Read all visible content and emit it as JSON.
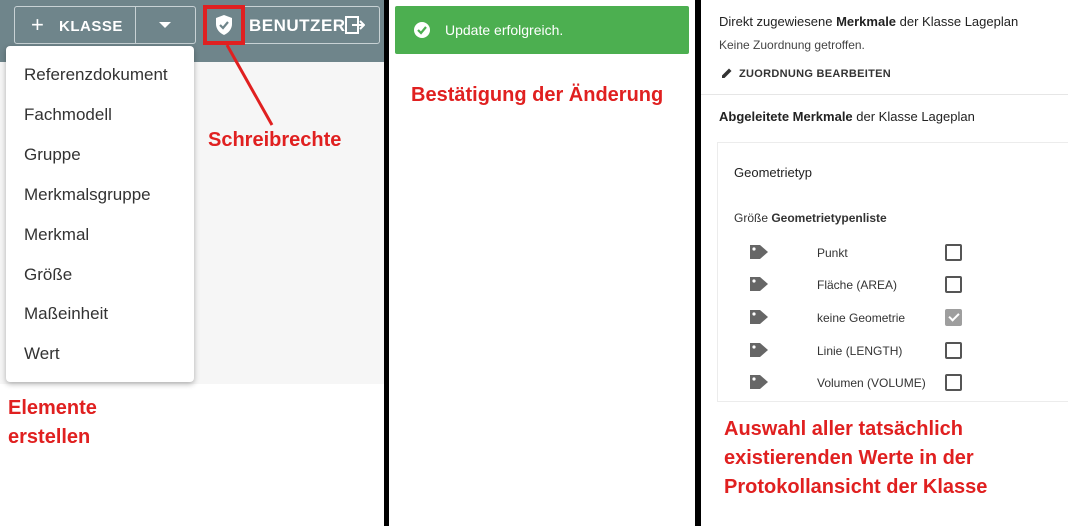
{
  "panel1": {
    "toolbar": {
      "new_class_button": "KLASSE",
      "user_button": "BENUTZER",
      "icons": [
        "plus-icon",
        "caret-down-icon",
        "shield-check-icon",
        "exit-icon"
      ]
    },
    "menu": {
      "items": [
        {
          "label": "Referenzdokument"
        },
        {
          "label": "Fachmodell"
        },
        {
          "label": "Gruppe"
        },
        {
          "label": "Merkmalsgruppe"
        },
        {
          "label": "Merkmal"
        },
        {
          "label": "Größe"
        },
        {
          "label": "Maßeinheit"
        },
        {
          "label": "Wert"
        }
      ]
    },
    "annotations": {
      "write_rights": "Schreibrechte",
      "create_elements_line1": "Elemente",
      "create_elements_line2": "erstellen"
    }
  },
  "panel2": {
    "toast": {
      "message": "Update erfolgreich."
    },
    "annotation": "Bestätigung der Änderung"
  },
  "panel3": {
    "direct": {
      "prefix": "Direkt zugewiesene ",
      "bold": "Merkmale",
      "suffix": " der Klasse Lageplan",
      "none": "Keine Zuordnung getroffen.",
      "edit_button": "ZUORDNUNG BEARBEITEN"
    },
    "derived": {
      "bold": "Abgeleitete Merkmale",
      "suffix": " der Klasse Lageplan"
    },
    "card": {
      "title": "Geometrietyp",
      "subtitle_prefix": "Größe ",
      "subtitle_bold": "Geometrietypenliste",
      "values": [
        {
          "label": "Punkt",
          "checked": false
        },
        {
          "label": "Fläche (AREA)",
          "checked": false
        },
        {
          "label": "keine Geometrie",
          "checked": true
        },
        {
          "label": "Linie (LENGTH)",
          "checked": false
        },
        {
          "label": "Volumen (VOLUME)",
          "checked": false
        }
      ]
    },
    "annotation": {
      "line1": "Auswahl aller tatsächlich",
      "line2": "existierenden Werte in der",
      "line3": "Protokollansicht der Klasse"
    }
  },
  "colors": {
    "toolbar": "#6f858b",
    "annotation_red": "#e02020",
    "success_green": "#4caf50"
  }
}
